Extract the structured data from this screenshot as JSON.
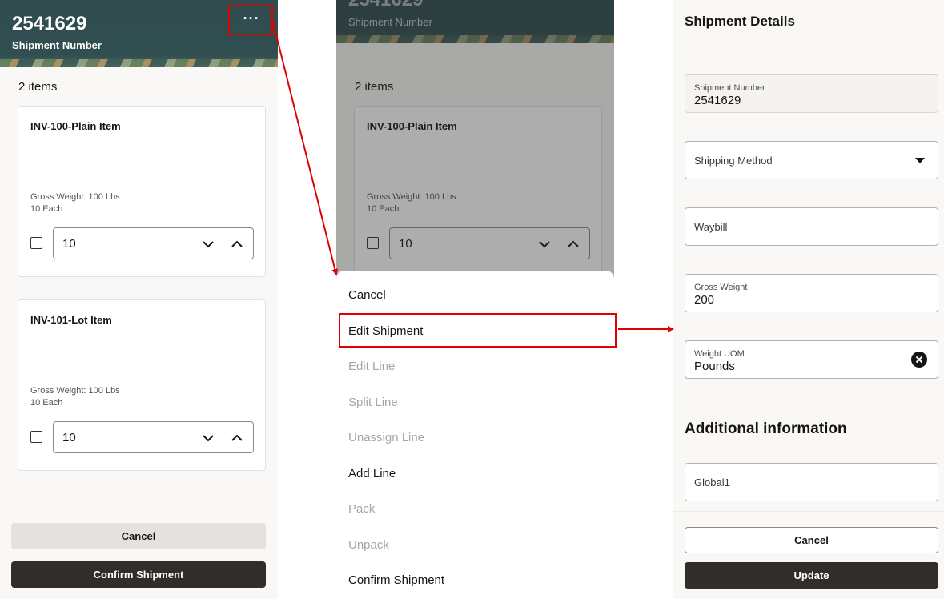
{
  "screen1": {
    "header": {
      "title": "2541629",
      "subtitle": "Shipment Number",
      "more_label": "···"
    },
    "items_count": "2 items",
    "items": [
      {
        "name": "INV-100-Plain Item",
        "gross_weight": "Gross Weight: 100 Lbs",
        "qty_uom": "10 Each",
        "quantity": "10"
      },
      {
        "name": "INV-101-Lot Item",
        "gross_weight": "Gross Weight: 100 Lbs",
        "qty_uom": "10 Each",
        "quantity": "10"
      }
    ],
    "cancel_label": "Cancel",
    "confirm_label": "Confirm Shipment"
  },
  "screen2": {
    "header": {
      "title": "2541629",
      "subtitle": "Shipment Number"
    },
    "items_count": "2 items",
    "item": {
      "name": "INV-100-Plain Item",
      "gross_weight": "Gross Weight: 100 Lbs",
      "qty_uom": "10 Each",
      "quantity": "10"
    },
    "menu": [
      {
        "label": "Cancel",
        "enabled": true
      },
      {
        "label": "Edit Shipment",
        "enabled": true
      },
      {
        "label": "Edit Line",
        "enabled": false
      },
      {
        "label": "Split Line",
        "enabled": false
      },
      {
        "label": "Unassign Line",
        "enabled": false
      },
      {
        "label": "Add Line",
        "enabled": true
      },
      {
        "label": "Pack",
        "enabled": false
      },
      {
        "label": "Unpack",
        "enabled": false
      },
      {
        "label": "Confirm Shipment",
        "enabled": true
      }
    ]
  },
  "screen3": {
    "title": "Shipment Details",
    "shipment_number": {
      "label": "Shipment Number",
      "value": "2541629"
    },
    "shipping_method": {
      "label": "Shipping Method"
    },
    "waybill": {
      "label": "Waybill"
    },
    "gross_weight": {
      "label": "Gross Weight",
      "value": "200"
    },
    "weight_uom": {
      "label": "Weight UOM",
      "value": "Pounds"
    },
    "additional_info_title": "Additional information",
    "global1": {
      "label": "Global1"
    },
    "cancel_label": "Cancel",
    "update_label": "Update"
  },
  "colors": {
    "highlight": "#e00000",
    "header_bg": "#2f4c4e",
    "dark_button": "#312d2a"
  }
}
